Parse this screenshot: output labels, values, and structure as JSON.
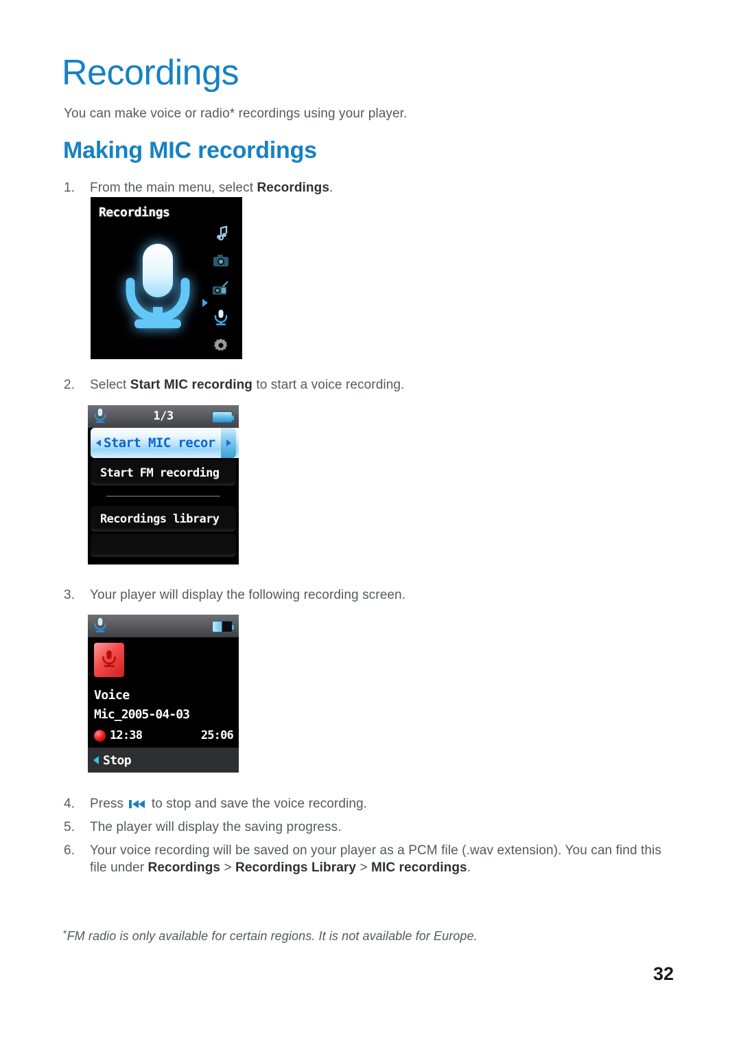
{
  "document": {
    "heading": "Recordings",
    "intro": "You can make voice or radio* recordings using your player.",
    "section_heading": "Making MIC recordings",
    "footnote_marker": "*",
    "footnote": "FM radio is only available for certain regions. It is not available for Europe.",
    "page_number": "32",
    "accent_color": "#1681c4"
  },
  "steps": [
    {
      "number": "1.",
      "text_before": "From the main menu, select ",
      "bold": "Recordings",
      "text_after": "."
    },
    {
      "number": "2.",
      "text_before": "Select ",
      "bold": "Start MIC recording",
      "text_after": " to start a voice recording."
    },
    {
      "number": "3.",
      "text_before": "Your player will display the following recording screen.",
      "bold": "",
      "text_after": ""
    },
    {
      "number": "4.",
      "text_before": "Press ",
      "bold": "",
      "text_after": " to stop and save the voice recording."
    },
    {
      "number": "5.",
      "text_before": "The player will display the saving progress.",
      "bold": "",
      "text_after": ""
    },
    {
      "number": "6.",
      "text_before": "Your voice recording will be saved on your player as a PCM file (.wav extension). You can find this file under ",
      "bold": "Recordings",
      "sep1": " > ",
      "bold2": "Recordings Library",
      "sep2": " > ",
      "bold3": "MIC recordings",
      "text_after": "."
    }
  ],
  "screens": {
    "splash": {
      "title": "Recordings",
      "main_icon": "microphone-icon",
      "side_icons": [
        {
          "name": "music-note-icon",
          "selected": false
        },
        {
          "name": "camera-icon",
          "selected": false
        },
        {
          "name": "radio-icon",
          "selected": false
        },
        {
          "name": "microphone-icon",
          "selected": true
        },
        {
          "name": "gear-icon",
          "selected": false
        }
      ]
    },
    "menu": {
      "status_icon": "microphone-icon",
      "status_label": "1/3",
      "battery_icon": "battery-full-icon",
      "items": [
        {
          "label": "Start MIC recor",
          "selected": true
        },
        {
          "label": "Start FM recording",
          "selected": false
        },
        {
          "label": "",
          "separator": true
        },
        {
          "label": "Recordings library",
          "selected": false
        },
        {
          "label": "",
          "blank": true
        }
      ]
    },
    "recording": {
      "status_icon": "microphone-icon",
      "battery_icon": "battery-half-icon",
      "rec_icon": "record-microphone-icon",
      "source": "Voice",
      "filename": "Mic_2005-04-03",
      "elapsed": "12:38",
      "total": "25:06",
      "bottom_action": "Stop"
    }
  }
}
